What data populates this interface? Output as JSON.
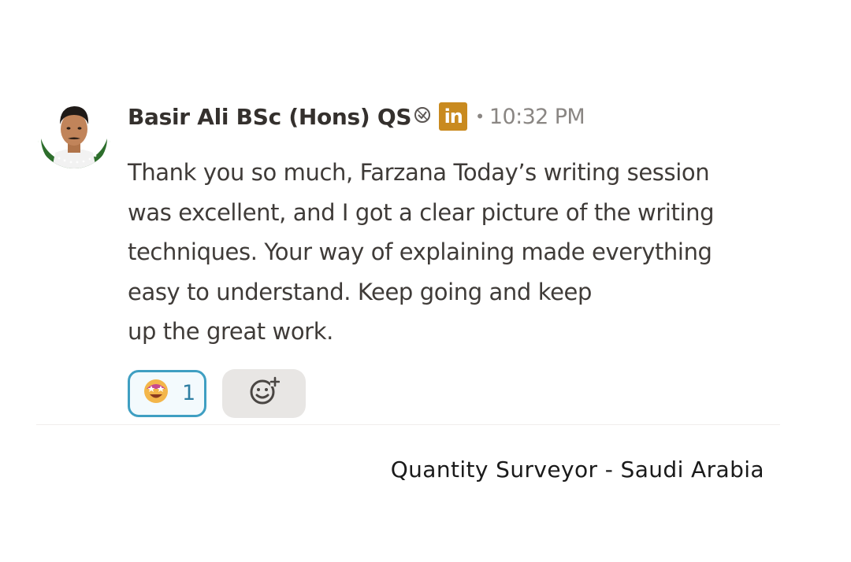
{
  "message": {
    "author": "Basir Ali BSc (Hons) QS",
    "author_badge_icon": "verified-badge-icon",
    "linkedin_label": "in",
    "separator": "•",
    "timestamp": "10:32 PM",
    "lines": [
      "Thank you so much, Farzana Today’s writing session",
      "was excellent, and I got a clear picture of the writing",
      "techniques. Your way of explaining made everything",
      "easy to understand. Keep going and keep",
      "up the great work."
    ],
    "reactions": [
      {
        "emoji_icon": "star-struck-emoji-icon",
        "count": "1"
      }
    ],
    "add_reaction_icon": "add-reaction-icon"
  },
  "caption": "Quantity Surveyor - Saudi Arabia",
  "colors": {
    "reaction_border": "#3f9fc2",
    "linkedin_badge": "#c98a1f",
    "add_reaction_bg": "#e8e6e4",
    "timestamp": "#8a8683"
  }
}
